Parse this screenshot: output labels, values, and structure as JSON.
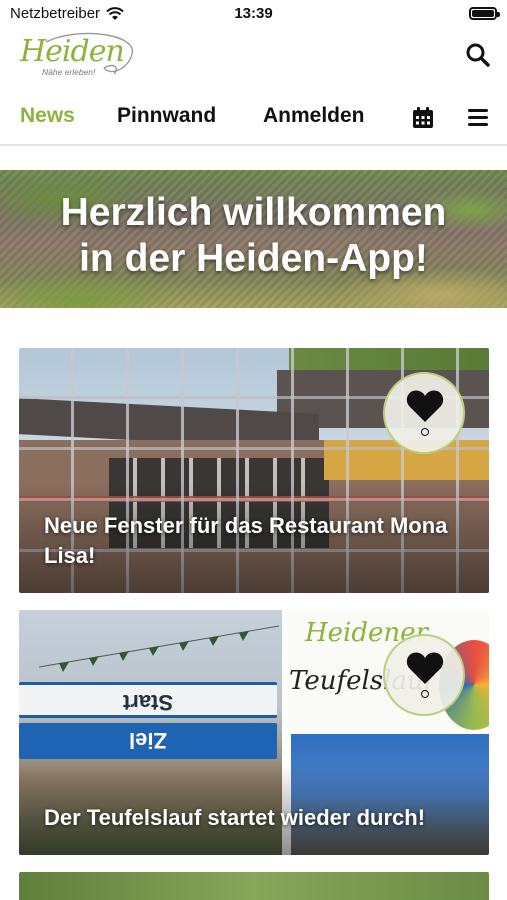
{
  "status_bar": {
    "carrier": "Netzbetreiber",
    "time": "13:39",
    "icons": [
      "wifi-icon",
      "battery-icon"
    ]
  },
  "header": {
    "logo_text": "Heiden",
    "logo_tagline": "Nähe erleben!",
    "search_icon": "search-icon",
    "accent_color": "#8cb43c"
  },
  "nav": {
    "tabs": [
      {
        "label": "News",
        "active": true
      },
      {
        "label": "Pinnwand",
        "active": false
      },
      {
        "label": "Anmelden",
        "active": false
      }
    ],
    "calendar_icon": "calendar-icon",
    "menu_icon": "menu-icon"
  },
  "hero": {
    "line1": "Herzlich willkommen",
    "line2": "in der Heiden-App!"
  },
  "news": [
    {
      "title": "Neue Fenster für das Restaurant Mona Lisa!",
      "favorite_icon": "heart-icon"
    },
    {
      "title": "Der Teufelslauf startet wieder durch!",
      "favorite_icon": "heart-icon",
      "image_text": {
        "banner1": "Start",
        "banner2": "Ziel",
        "logo_line1": "Heidener",
        "logo_line2": "Teufelslauf"
      }
    }
  ]
}
